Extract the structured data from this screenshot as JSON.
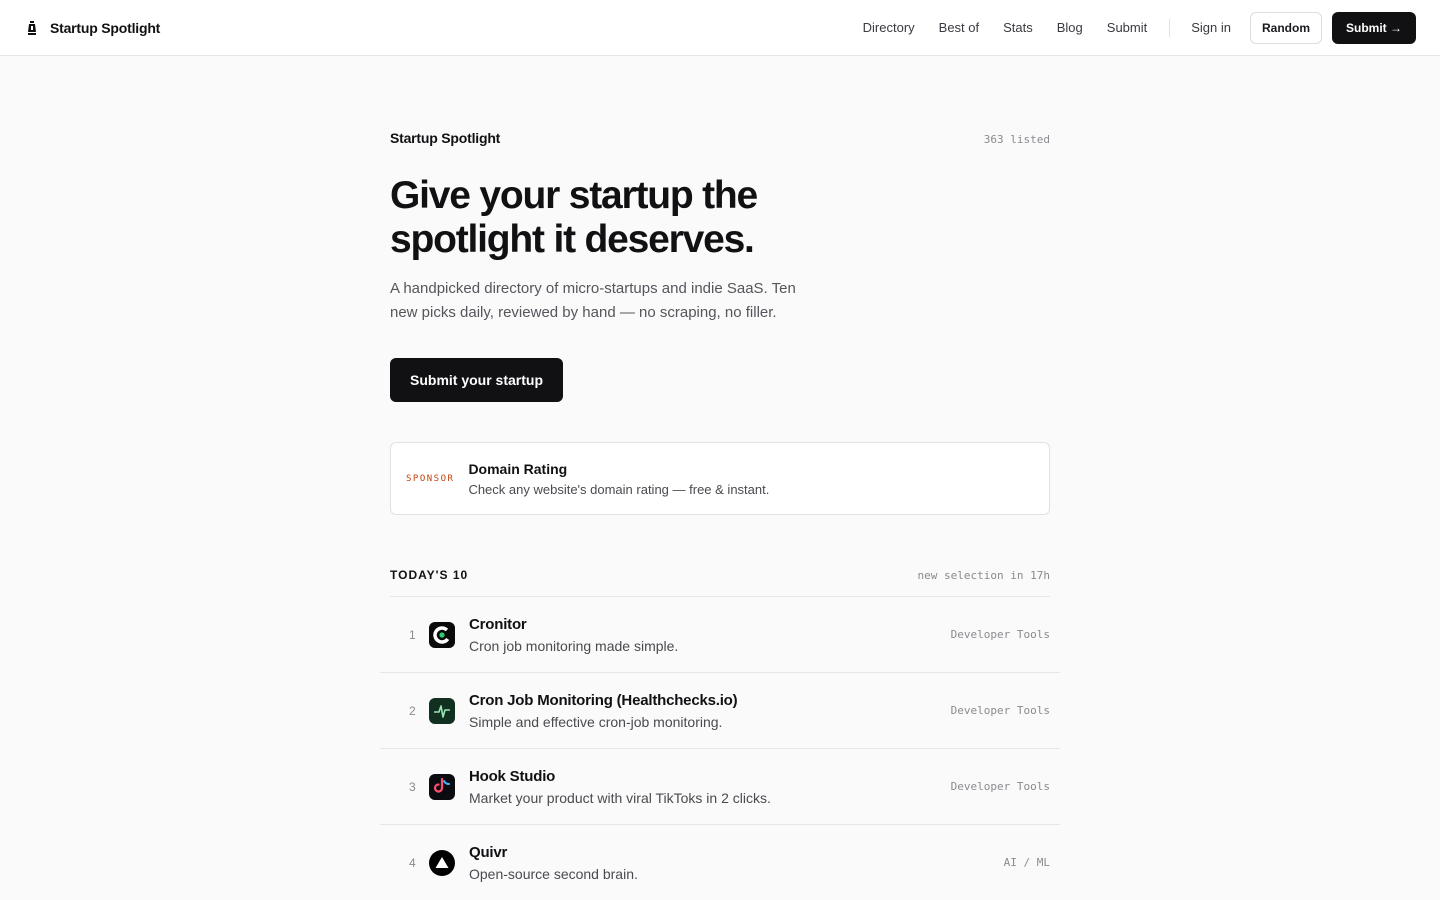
{
  "nav": {
    "brand": "Startup Spotlight",
    "links": [
      "Directory",
      "Best of",
      "Stats",
      "Blog",
      "Submit"
    ],
    "sign_in": "Sign in",
    "random": "Random",
    "submit": "Submit →"
  },
  "hero": {
    "kicker": "Startup Spotlight",
    "count": "363 listed",
    "title": "Give your startup the spotlight it deserves.",
    "lead": "A handpicked directory of micro-startups and indie SaaS. Ten new picks daily, reviewed by hand — no scraping, no filler.",
    "cta": "Submit your startup"
  },
  "sponsor": {
    "badge": "SPONSOR",
    "title": "Domain Rating",
    "desc": "Check any website's domain rating — free & instant."
  },
  "list": {
    "title": "TODAY'S 10",
    "note": "new selection in 17h",
    "items": [
      {
        "rank": "1",
        "name": "Cronitor",
        "desc": "Cron job monitoring made simple.",
        "category": "Developer Tools",
        "icon": "cronitor-logo-icon"
      },
      {
        "rank": "2",
        "name": "Cron Job Monitoring (Healthchecks.io)",
        "desc": "Simple and effective cron-job monitoring.",
        "category": "Developer Tools",
        "icon": "healthchecks-logo-icon"
      },
      {
        "rank": "3",
        "name": "Hook Studio",
        "desc": "Market your product with viral TikToks in 2 clicks.",
        "category": "Developer Tools",
        "icon": "hook-studio-logo-icon"
      },
      {
        "rank": "4",
        "name": "Quivr",
        "desc": "Open-source second brain.",
        "category": "AI / ML",
        "icon": "quivr-logo-icon"
      }
    ]
  },
  "colors": {
    "ink": "#111114",
    "sponsor_accent": "#c2410c",
    "background": "#fafafa"
  }
}
